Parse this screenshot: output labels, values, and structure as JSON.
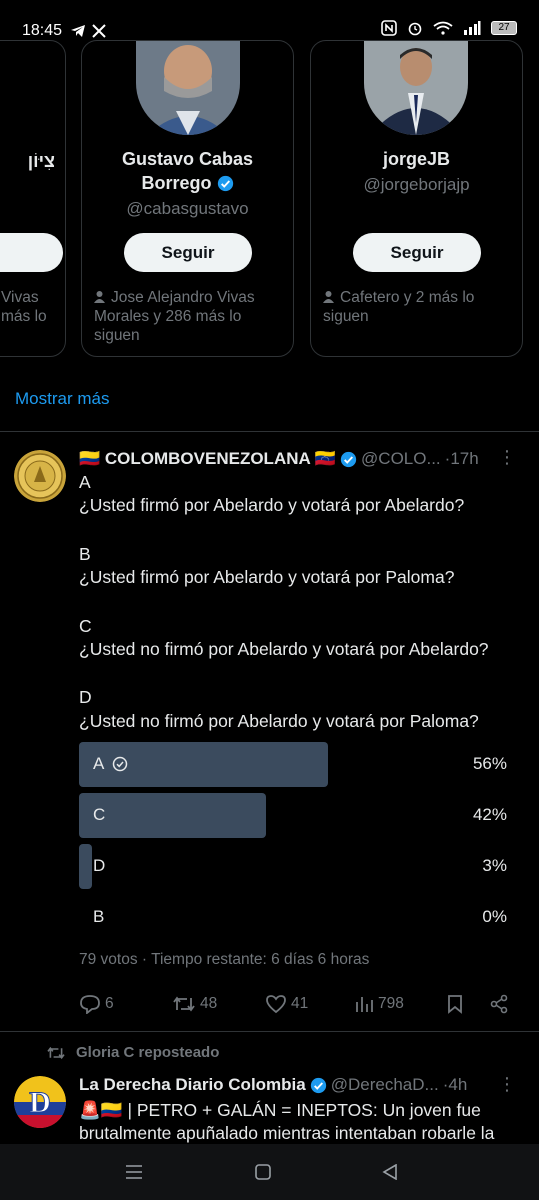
{
  "status_bar": {
    "time": "18:45",
    "left_icons": [
      "telegram-icon",
      "x-icon"
    ],
    "right_icons": [
      "nfc-icon",
      "alarm-icon",
      "wifi-icon",
      "signal-icon"
    ],
    "battery": "27"
  },
  "suggestions": {
    "partial_card": {
      "name": "צִיּוֹן",
      "followers_text": "Vivas\nmás lo"
    },
    "cards": [
      {
        "name_line1": "Gustavo Cabas",
        "name_line2": "Borrego",
        "handle": "@cabasgustavo",
        "follow_label": "Seguir",
        "followers_text": "Jose Alejandro Vivas Morales y 286 más lo siguen"
      },
      {
        "name": "jorgeJB",
        "handle": "@jorgeborjajp",
        "follow_label": "Seguir",
        "followers_text": "Cafetero y 2 más lo siguen"
      }
    ],
    "show_more": "Mostrar más"
  },
  "tweet": {
    "author": "🇨🇴 COLOMBOVENEZOLANA 🇻🇪",
    "handle": "@COLO...",
    "time": "·17h",
    "body": [
      "A",
      "¿Usted firmó por Abelardo y votará por Abelardo?",
      "",
      "B",
      "¿Usted firmó por Abelardo y votará por Paloma?",
      "",
      "C",
      "¿Usted no firmó por Abelardo y votará por Abelardo?",
      "",
      "D",
      "¿Usted no firmó por Abelardo y votará por Paloma?"
    ],
    "poll": {
      "options": [
        {
          "label": "A",
          "percent": "56%",
          "value": 56,
          "selected": true
        },
        {
          "label": "C",
          "percent": "42%",
          "value": 42,
          "selected": false
        },
        {
          "label": "D",
          "percent": "3%",
          "value": 3,
          "selected": false
        },
        {
          "label": "B",
          "percent": "0%",
          "value": 0,
          "selected": false
        }
      ],
      "meta": "79 votos · Tiempo restante: 6 días 6 horas"
    },
    "actions": {
      "replies": "6",
      "retweets": "48",
      "likes": "41",
      "views": "798"
    }
  },
  "retweet_notice": "Gloria C reposteado",
  "tweet2": {
    "author": "La Derecha Diario Colombia",
    "handle": "@DerechaD...",
    "time": "·4h",
    "body": "🚨🇨🇴 | PETRO + GALÁN = INEPTOS: Un joven fue brutalmente apuñalado mientras intentaban robarle la"
  },
  "colors": {
    "background": "#000000",
    "text": "#e7e9ea",
    "muted": "#71767b",
    "accent": "#1d9bf0",
    "poll_bar": "#3b4b5e",
    "divider": "#2f3336"
  }
}
